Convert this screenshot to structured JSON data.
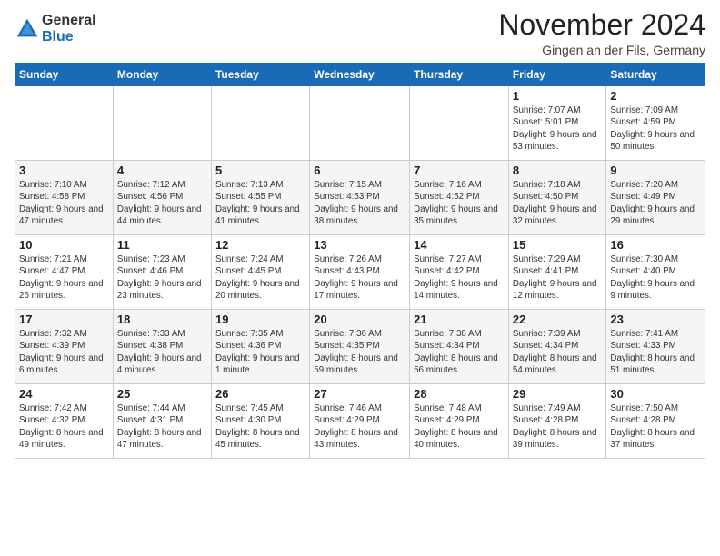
{
  "logo": {
    "general": "General",
    "blue": "Blue"
  },
  "title": "November 2024",
  "subtitle": "Gingen an der Fils, Germany",
  "days_header": [
    "Sunday",
    "Monday",
    "Tuesday",
    "Wednesday",
    "Thursday",
    "Friday",
    "Saturday"
  ],
  "weeks": [
    [
      {
        "day": "",
        "info": ""
      },
      {
        "day": "",
        "info": ""
      },
      {
        "day": "",
        "info": ""
      },
      {
        "day": "",
        "info": ""
      },
      {
        "day": "",
        "info": ""
      },
      {
        "day": "1",
        "info": "Sunrise: 7:07 AM\nSunset: 5:01 PM\nDaylight: 9 hours and 53 minutes."
      },
      {
        "day": "2",
        "info": "Sunrise: 7:09 AM\nSunset: 4:59 PM\nDaylight: 9 hours and 50 minutes."
      }
    ],
    [
      {
        "day": "3",
        "info": "Sunrise: 7:10 AM\nSunset: 4:58 PM\nDaylight: 9 hours and 47 minutes."
      },
      {
        "day": "4",
        "info": "Sunrise: 7:12 AM\nSunset: 4:56 PM\nDaylight: 9 hours and 44 minutes."
      },
      {
        "day": "5",
        "info": "Sunrise: 7:13 AM\nSunset: 4:55 PM\nDaylight: 9 hours and 41 minutes."
      },
      {
        "day": "6",
        "info": "Sunrise: 7:15 AM\nSunset: 4:53 PM\nDaylight: 9 hours and 38 minutes."
      },
      {
        "day": "7",
        "info": "Sunrise: 7:16 AM\nSunset: 4:52 PM\nDaylight: 9 hours and 35 minutes."
      },
      {
        "day": "8",
        "info": "Sunrise: 7:18 AM\nSunset: 4:50 PM\nDaylight: 9 hours and 32 minutes."
      },
      {
        "day": "9",
        "info": "Sunrise: 7:20 AM\nSunset: 4:49 PM\nDaylight: 9 hours and 29 minutes."
      }
    ],
    [
      {
        "day": "10",
        "info": "Sunrise: 7:21 AM\nSunset: 4:47 PM\nDaylight: 9 hours and 26 minutes."
      },
      {
        "day": "11",
        "info": "Sunrise: 7:23 AM\nSunset: 4:46 PM\nDaylight: 9 hours and 23 minutes."
      },
      {
        "day": "12",
        "info": "Sunrise: 7:24 AM\nSunset: 4:45 PM\nDaylight: 9 hours and 20 minutes."
      },
      {
        "day": "13",
        "info": "Sunrise: 7:26 AM\nSunset: 4:43 PM\nDaylight: 9 hours and 17 minutes."
      },
      {
        "day": "14",
        "info": "Sunrise: 7:27 AM\nSunset: 4:42 PM\nDaylight: 9 hours and 14 minutes."
      },
      {
        "day": "15",
        "info": "Sunrise: 7:29 AM\nSunset: 4:41 PM\nDaylight: 9 hours and 12 minutes."
      },
      {
        "day": "16",
        "info": "Sunrise: 7:30 AM\nSunset: 4:40 PM\nDaylight: 9 hours and 9 minutes."
      }
    ],
    [
      {
        "day": "17",
        "info": "Sunrise: 7:32 AM\nSunset: 4:39 PM\nDaylight: 9 hours and 6 minutes."
      },
      {
        "day": "18",
        "info": "Sunrise: 7:33 AM\nSunset: 4:38 PM\nDaylight: 9 hours and 4 minutes."
      },
      {
        "day": "19",
        "info": "Sunrise: 7:35 AM\nSunset: 4:36 PM\nDaylight: 9 hours and 1 minute."
      },
      {
        "day": "20",
        "info": "Sunrise: 7:36 AM\nSunset: 4:35 PM\nDaylight: 8 hours and 59 minutes."
      },
      {
        "day": "21",
        "info": "Sunrise: 7:38 AM\nSunset: 4:34 PM\nDaylight: 8 hours and 56 minutes."
      },
      {
        "day": "22",
        "info": "Sunrise: 7:39 AM\nSunset: 4:34 PM\nDaylight: 8 hours and 54 minutes."
      },
      {
        "day": "23",
        "info": "Sunrise: 7:41 AM\nSunset: 4:33 PM\nDaylight: 8 hours and 51 minutes."
      }
    ],
    [
      {
        "day": "24",
        "info": "Sunrise: 7:42 AM\nSunset: 4:32 PM\nDaylight: 8 hours and 49 minutes."
      },
      {
        "day": "25",
        "info": "Sunrise: 7:44 AM\nSunset: 4:31 PM\nDaylight: 8 hours and 47 minutes."
      },
      {
        "day": "26",
        "info": "Sunrise: 7:45 AM\nSunset: 4:30 PM\nDaylight: 8 hours and 45 minutes."
      },
      {
        "day": "27",
        "info": "Sunrise: 7:46 AM\nSunset: 4:29 PM\nDaylight: 8 hours and 43 minutes."
      },
      {
        "day": "28",
        "info": "Sunrise: 7:48 AM\nSunset: 4:29 PM\nDaylight: 8 hours and 40 minutes."
      },
      {
        "day": "29",
        "info": "Sunrise: 7:49 AM\nSunset: 4:28 PM\nDaylight: 8 hours and 39 minutes."
      },
      {
        "day": "30",
        "info": "Sunrise: 7:50 AM\nSunset: 4:28 PM\nDaylight: 8 hours and 37 minutes."
      }
    ]
  ]
}
